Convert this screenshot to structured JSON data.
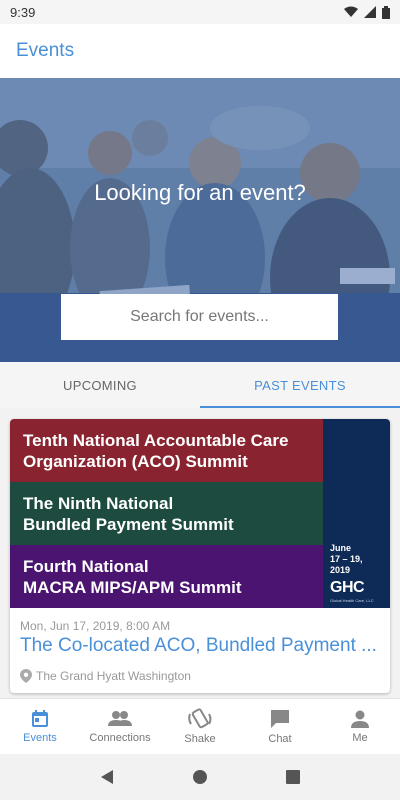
{
  "status_bar": {
    "time": "9:39"
  },
  "app_bar": {
    "title": "Events"
  },
  "hero": {
    "heading": "Looking for an event?",
    "search_placeholder": "Search for events..."
  },
  "tabs": [
    {
      "label": "UPCOMING",
      "active": false
    },
    {
      "label": "PAST EVENTS",
      "active": true
    }
  ],
  "events": [
    {
      "banner": {
        "line1a": "Tenth National Accountable Care",
        "line1b": "Organization (ACO) Summit",
        "line2a": "The Ninth National",
        "line2b": "Bundled Payment Summit",
        "line3a": "Fourth National",
        "line3b": "MACRA MIPS/APM Summit",
        "date_line1": "June",
        "date_line2": "17 – 19,",
        "date_line3": "2019",
        "logo": "GHC",
        "logo_tagline": "Global Health Care, LLC"
      },
      "datetime": "Mon, Jun 17, 2019, 8:00 AM",
      "title": "The Co-located ACO, Bundled Payment ...",
      "location": "The Grand Hyatt Washington"
    }
  ],
  "bottom_nav": [
    {
      "label": "Events",
      "icon": "calendar-icon",
      "active": true
    },
    {
      "label": "Connections",
      "icon": "people-icon",
      "active": false
    },
    {
      "label": "Shake",
      "icon": "shake-icon",
      "active": false
    },
    {
      "label": "Chat",
      "icon": "chat-icon",
      "active": false
    },
    {
      "label": "Me",
      "icon": "person-icon",
      "active": false
    }
  ],
  "colors": {
    "accent": "#4a90d9",
    "band1": "#8a2330",
    "band2": "#1d4b40",
    "band3": "#4a1470",
    "side": "#0e2a56"
  }
}
